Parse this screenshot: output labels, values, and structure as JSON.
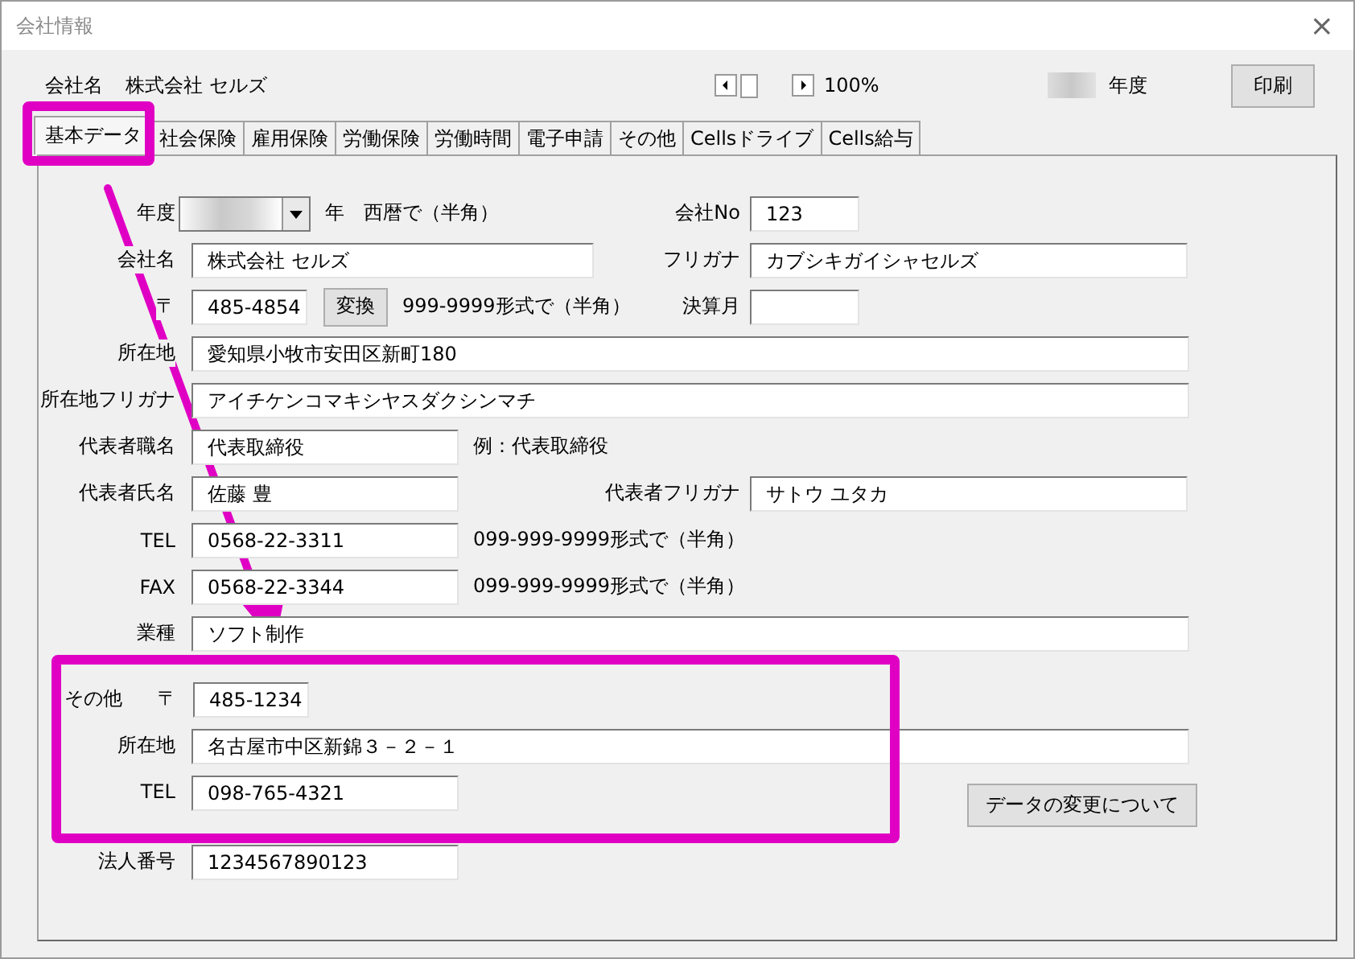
{
  "window": {
    "title": "会社情報",
    "close": "×"
  },
  "header": {
    "company_label": "会社名",
    "company_name": "株式会社 セルズ",
    "zoom": "100%",
    "year_suffix": "年度",
    "print_button": "印刷"
  },
  "tabs": [
    {
      "label": "基本データ",
      "selected": true
    },
    {
      "label": "社会保険",
      "selected": false
    },
    {
      "label": "雇用保険",
      "selected": false
    },
    {
      "label": "労働保険",
      "selected": false
    },
    {
      "label": "労働時間",
      "selected": false
    },
    {
      "label": "電子申請",
      "selected": false
    },
    {
      "label": "その他",
      "selected": false
    },
    {
      "label": "Cellsドライブ",
      "selected": false
    },
    {
      "label": "Cells給与",
      "selected": false
    }
  ],
  "form": {
    "year": {
      "label": "年度",
      "unit": "年",
      "note": "西暦で（半角）"
    },
    "company_no": {
      "label": "会社No",
      "value": "123"
    },
    "company_name": {
      "label": "会社名",
      "value": "株式会社  セルズ"
    },
    "furigana": {
      "label": "フリガナ",
      "value": "カブシキガイシャセルズ"
    },
    "postal": {
      "label": "〒",
      "value": "485-4854",
      "button": "変換",
      "note": "999-9999形式で（半角）"
    },
    "fiscal_month": {
      "label": "決算月"
    },
    "address": {
      "label": "所在地",
      "value": "愛知県小牧市安田区新町180"
    },
    "address_kana": {
      "label": "所在地フリガナ",
      "value": "アイチケンコマキシヤスダクシンマチ"
    },
    "rep_title": {
      "label": "代表者職名",
      "value": "代表取締役",
      "note": "例：代表取締役"
    },
    "rep_name": {
      "label": "代表者氏名",
      "value": "佐藤  豊"
    },
    "rep_kana": {
      "label": "代表者フリガナ",
      "value": "サトウ  ユタカ"
    },
    "tel": {
      "label": "TEL",
      "value": "0568-22-3311",
      "note": "099-999-9999形式で（半角）"
    },
    "fax": {
      "label": "FAX",
      "value": "0568-22-3344",
      "note": "099-999-9999形式で（半角）"
    },
    "industry": {
      "label": "業種",
      "value": "ソフト制作"
    },
    "other": {
      "label": "その他",
      "postal_label": "〒",
      "postal": "485-1234",
      "address_label": "所在地",
      "address": "名古屋市中区新錦３－２－１",
      "tel_label": "TEL",
      "tel": "098-765-4321"
    },
    "change_button": "データの変更について",
    "corp_number": {
      "label": "法人番号",
      "value": "1234567890123"
    }
  }
}
